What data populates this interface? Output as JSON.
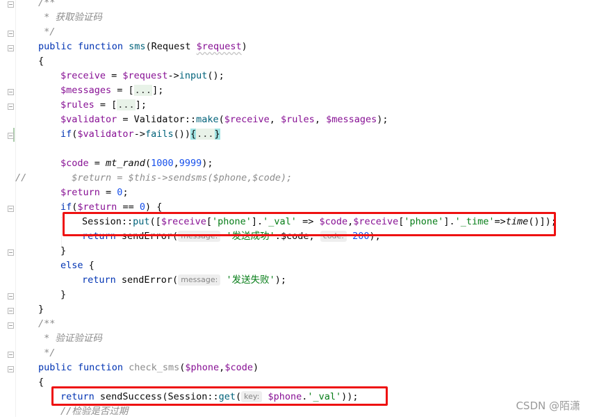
{
  "code": {
    "c1_open": "/**",
    "c1_text": " * 获取验证码",
    "c1_close": " */",
    "fn1": {
      "public": "public",
      "function": "function",
      "name": "sms",
      "open": "(Request ",
      "param": "$request",
      "close": ")"
    },
    "brace_open": "{",
    "receive": {
      "var": "$receive",
      "eq": " = ",
      "req": "$request",
      "arrow": "->",
      "call": "input",
      "end": "();"
    },
    "messages": {
      "var": "$messages",
      "eq": " = [",
      "fold": "...",
      "end": "];"
    },
    "rules": {
      "var": "$rules",
      "eq": " = [",
      "fold": "...",
      "end": "];"
    },
    "validator": {
      "var": "$validator",
      "eq": " = Validator::",
      "call": "make",
      "open": "(",
      "a1": "$receive",
      "sep1": ", ",
      "a2": "$rules",
      "sep2": ", ",
      "a3": "$messages",
      "end": ");"
    },
    "if_fails": {
      "if": "if",
      "open": "(",
      "var": "$validator",
      "arrow": "->",
      "call": "fails",
      "mid": "())",
      "brace": "{",
      "fold": "...",
      "brace_close": "}"
    },
    "code_line": {
      "var": "$code",
      "eq": " = ",
      "call": "mt_rand",
      "open": "(",
      "n1": "1000",
      "comma": ",",
      "n2": "9999",
      "end": ");"
    },
    "commented": {
      "slashes": "//",
      "text": "        $return = $this->sendsms($phone,$code);"
    },
    "return_line": {
      "var": "$return",
      "eq": " = ",
      "n": "0",
      "end": ";"
    },
    "if_return": {
      "if": "if",
      "open": "(",
      "var": "$return",
      "eq": " == ",
      "n": "0",
      "end": ") {"
    },
    "session_put": {
      "cls": "Session::",
      "call": "put",
      "open": "([",
      "v1": "$receive",
      "b1": "[",
      "s1": "'phone'",
      "b2": "].",
      "s2": "'_val'",
      "arrow": " => ",
      "v2": "$code",
      "comma": ",",
      "v3": "$receive",
      "b3": "[",
      "s3": "'phone'",
      "b4": "].",
      "s4": "'_time'",
      "arrow2": "=>",
      "call2": "time",
      "end": "()]);"
    },
    "send_err1": {
      "return": "return",
      "fn": " sendError(",
      "hint1": "message:",
      "s1": "'发送成功'",
      "mid": ".$code, ",
      "hint2": "code:",
      "n": "200",
      "end": ");"
    },
    "close_if": "}",
    "else": {
      "kw": "else",
      "end": " {"
    },
    "send_err2": {
      "return": "return",
      "fn": " sendError(",
      "hint": "message:",
      "s": "'发送失败'",
      "end": ");"
    },
    "close_else": "}",
    "close_fn": "}",
    "c2_open": "/**",
    "c2_text": " * 验证验证码",
    "c2_close": " */",
    "fn2": {
      "public": "public",
      "function": "function",
      "name": "check_sms",
      "open": "(",
      "p1": "$phone",
      "comma": ",",
      "p2": "$code",
      "close": ")"
    },
    "brace_open2": "{",
    "return_success": {
      "return": "return",
      "fn": " sendSuccess(Session::",
      "call": "get",
      "open": "(",
      "hint": "key:",
      "var": "$phone",
      "dot": ".",
      "s": "'_val'",
      "end": "));"
    },
    "last_comment": "//检验是否过期"
  },
  "watermark": "CSDN @陌潇"
}
